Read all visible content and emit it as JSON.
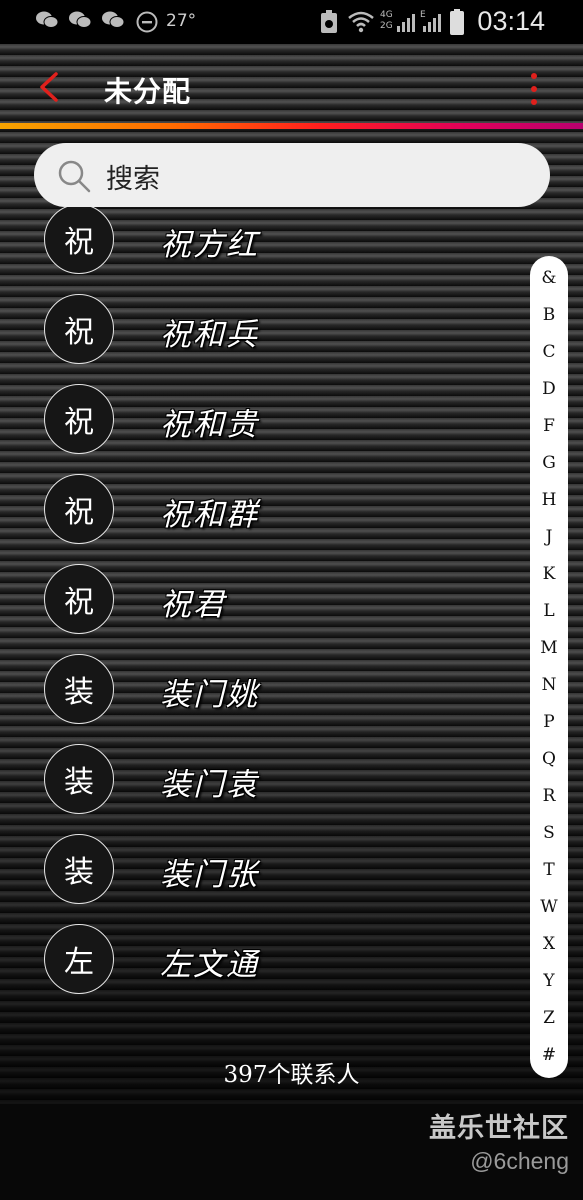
{
  "status_bar": {
    "temperature": "27°",
    "network_4g": "4G",
    "network_2g": "2G",
    "network_e": "E",
    "time": "03:14",
    "icons": [
      "wechat-icon",
      "wechat-icon",
      "wechat-icon",
      "do-not-disturb-icon",
      "recycle-icon",
      "wifi-icon",
      "signal-icon",
      "signal-icon",
      "battery-icon"
    ]
  },
  "header": {
    "title": "未分配",
    "back_icon": "chevron-left-icon",
    "more_icon": "more-vertical-icon",
    "accent_color": "#e0201c"
  },
  "search": {
    "placeholder": "搜索"
  },
  "contacts": [
    {
      "initial": "祝",
      "name": "祝方红"
    },
    {
      "initial": "祝",
      "name": "祝和兵"
    },
    {
      "initial": "祝",
      "name": "祝和贵"
    },
    {
      "initial": "祝",
      "name": "祝和群"
    },
    {
      "initial": "祝",
      "name": "祝君"
    },
    {
      "initial": "装",
      "name": "装门姚"
    },
    {
      "initial": "装",
      "name": "装门袁"
    },
    {
      "initial": "装",
      "name": "装门张"
    },
    {
      "initial": "左",
      "name": "左文通"
    }
  ],
  "index_letters": [
    "&",
    "B",
    "C",
    "D",
    "F",
    "G",
    "H",
    "J",
    "K",
    "L",
    "M",
    "N",
    "P",
    "Q",
    "R",
    "S",
    "T",
    "W",
    "X",
    "Y",
    "Z",
    "#"
  ],
  "footer": {
    "count": "397个联系人"
  },
  "watermark": {
    "title": "盖乐世社区",
    "user": "@6cheng"
  }
}
